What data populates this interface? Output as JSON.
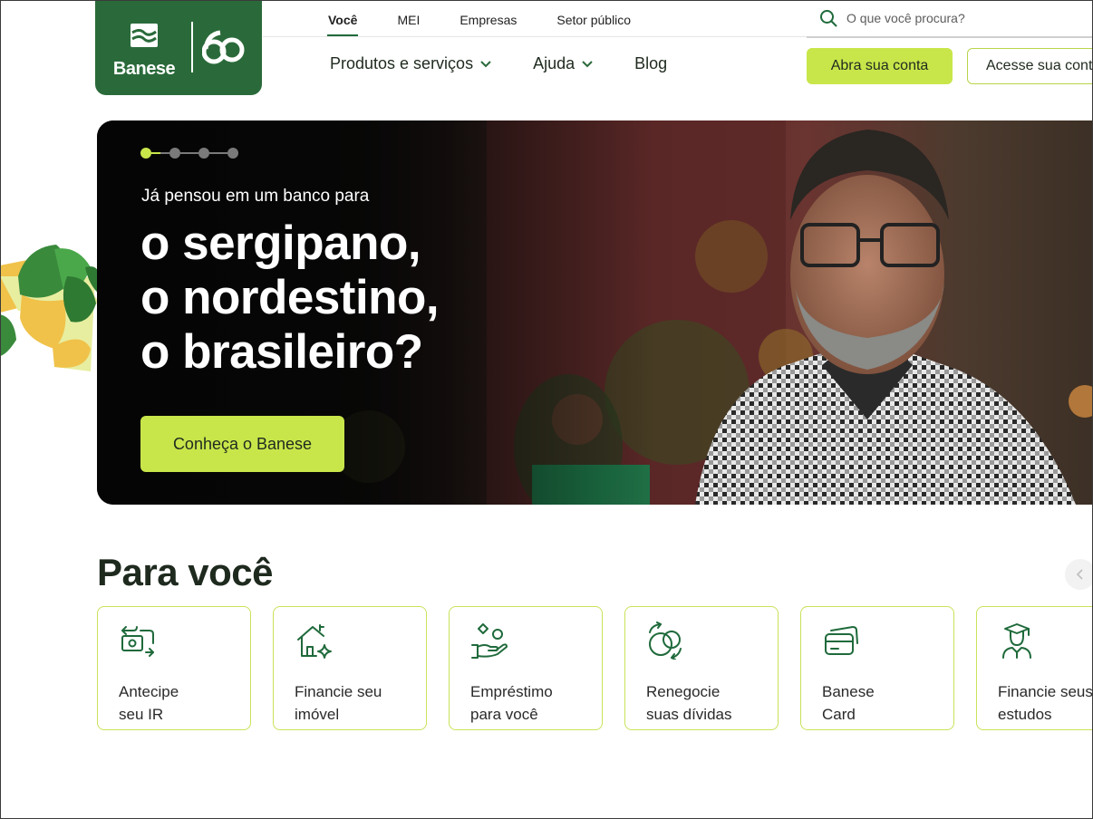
{
  "brand": {
    "name": "Banese",
    "anniversary": "60",
    "primary_color": "#2a6a3a",
    "accent_color": "#c8e64a"
  },
  "topnav": {
    "items": [
      {
        "label": "Você",
        "active": true
      },
      {
        "label": "MEI",
        "active": false
      },
      {
        "label": "Empresas",
        "active": false
      },
      {
        "label": "Setor público",
        "active": false
      }
    ]
  },
  "search": {
    "placeholder": "O que você procura?",
    "icon": "search-icon"
  },
  "mainnav": {
    "items": [
      {
        "label": "Produtos e serviços",
        "has_dropdown": true
      },
      {
        "label": "Ajuda",
        "has_dropdown": true
      },
      {
        "label": "Blog",
        "has_dropdown": false
      }
    ]
  },
  "actions": {
    "open_account": "Abra sua conta",
    "access_account": "Acesse sua conta"
  },
  "hero": {
    "slides_total": 4,
    "active_slide": 1,
    "subtitle": "Já pensou em um banco para",
    "title_lines": [
      "o sergipano,",
      "o nordestino,",
      "o brasileiro?"
    ],
    "cta": "Conheça o Banese"
  },
  "section": {
    "title": "Para você",
    "cards": [
      {
        "line1": "Antecipe",
        "line2": "seu IR",
        "icon": "money-exchange-icon"
      },
      {
        "line1": "Financie seu",
        "line2": "imóvel",
        "icon": "house-sparkle-icon"
      },
      {
        "line1": "Empréstimo",
        "line2": "para você",
        "icon": "hand-coins-icon"
      },
      {
        "line1": "Renegocie",
        "line2": "suas dívidas",
        "icon": "coins-cycle-icon"
      },
      {
        "line1": "Banese",
        "line2": "Card",
        "icon": "credit-card-icon"
      },
      {
        "line1": "Financie seus",
        "line2": "estudos",
        "icon": "graduate-icon"
      }
    ]
  }
}
